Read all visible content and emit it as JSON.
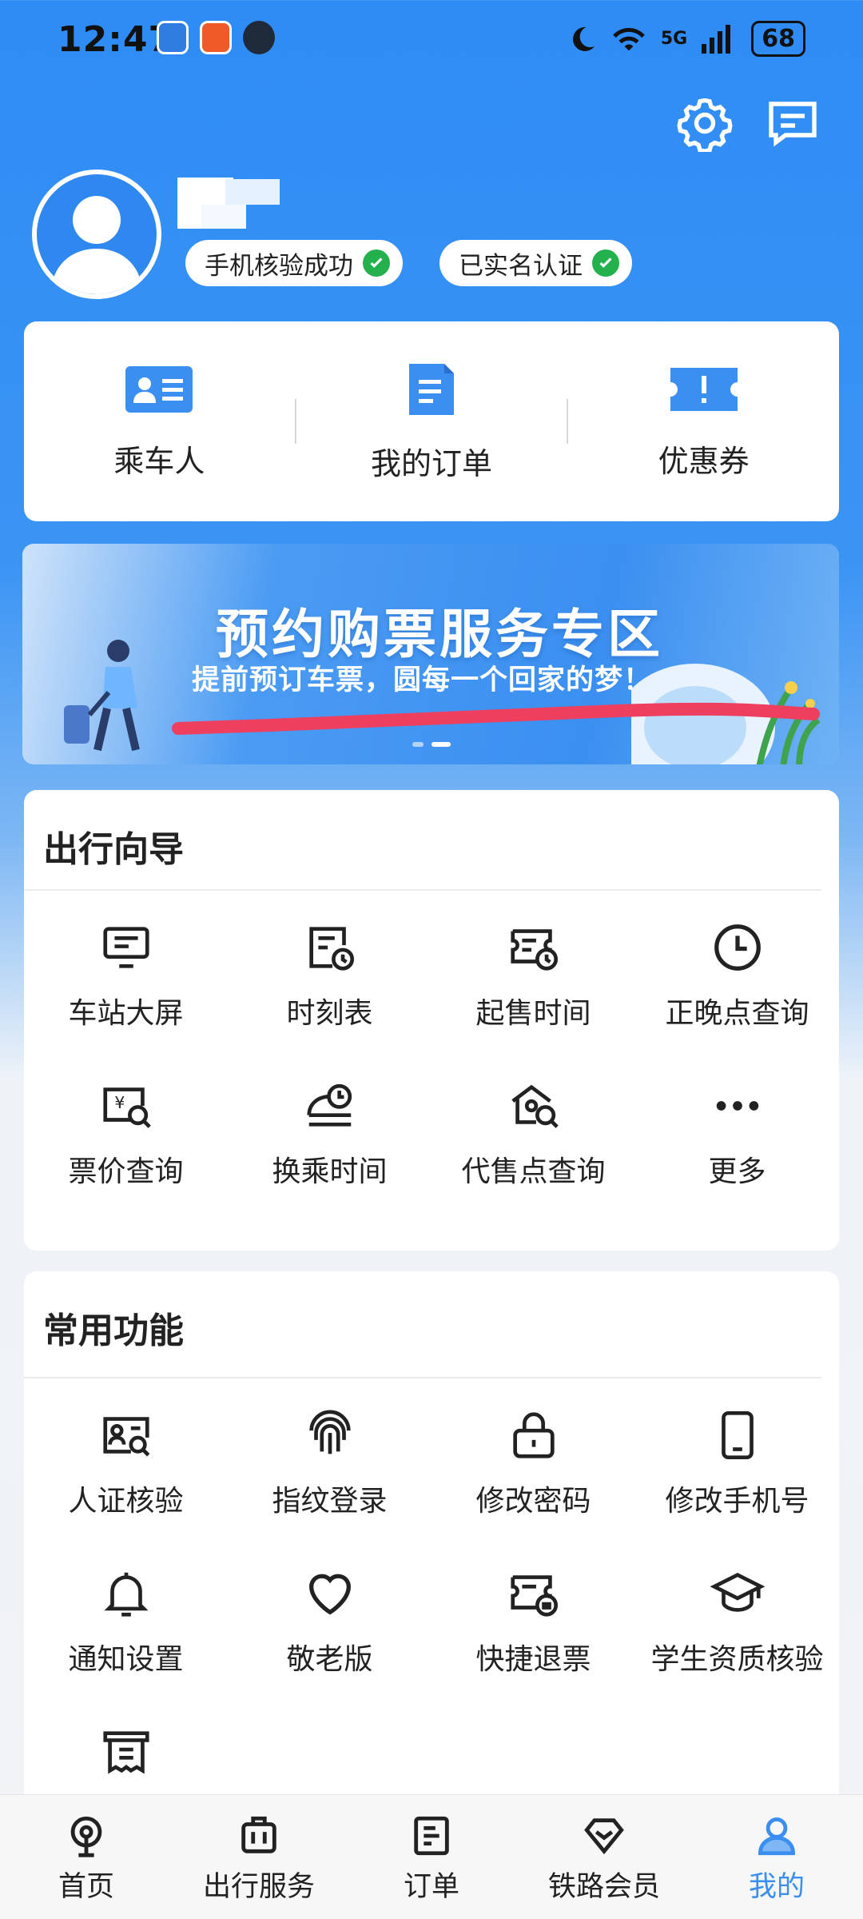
{
  "status_bar": {
    "time": "12:47",
    "network": "5G",
    "battery": "68"
  },
  "header": {
    "settings_icon": "gear-icon",
    "message_icon": "message-icon",
    "badges": [
      {
        "label": "手机核验成功"
      },
      {
        "label": "已实名认证"
      }
    ]
  },
  "quick_links": [
    {
      "label": "乘车人",
      "icon": "passenger-card-icon"
    },
    {
      "label": "我的订单",
      "icon": "order-doc-icon"
    },
    {
      "label": "优惠券",
      "icon": "coupon-icon"
    }
  ],
  "banner": {
    "title": "预约购票服务专区",
    "subtitle": "提前预订车票，圆每一个回家的梦！"
  },
  "travel_guide": {
    "title": "出行向导",
    "items": [
      {
        "label": "车站大屏",
        "icon": "monitor-icon"
      },
      {
        "label": "时刻表",
        "icon": "timetable-icon"
      },
      {
        "label": "起售时间",
        "icon": "ticket-clock-icon"
      },
      {
        "label": "正晚点查询",
        "icon": "clock-icon"
      },
      {
        "label": "票价查询",
        "icon": "price-search-icon"
      },
      {
        "label": "换乘时间",
        "icon": "transfer-time-icon"
      },
      {
        "label": "代售点查询",
        "icon": "agency-search-icon"
      },
      {
        "label": "更多",
        "icon": "more-icon"
      }
    ]
  },
  "common_functions": {
    "title": "常用功能",
    "items": [
      {
        "label": "人证核验",
        "icon": "id-verify-icon"
      },
      {
        "label": "指纹登录",
        "icon": "fingerprint-icon"
      },
      {
        "label": "修改密码",
        "icon": "lock-icon"
      },
      {
        "label": "修改手机号",
        "icon": "phone-icon"
      },
      {
        "label": "通知设置",
        "icon": "bell-icon"
      },
      {
        "label": "敬老版",
        "icon": "heart-icon"
      },
      {
        "label": "快捷退票",
        "icon": "refund-ticket-icon"
      },
      {
        "label": "学生资质核验",
        "icon": "graduation-cap-icon"
      },
      {
        "label": "",
        "icon": "receipt-icon"
      }
    ]
  },
  "bottom_nav": [
    {
      "label": "首页",
      "icon": "home-train-icon"
    },
    {
      "label": "出行服务",
      "icon": "luggage-icon"
    },
    {
      "label": "订单",
      "icon": "order-icon"
    },
    {
      "label": "铁路会员",
      "icon": "diamond-icon"
    },
    {
      "label": "我的",
      "icon": "profile-icon",
      "active": true
    }
  ],
  "colors": {
    "primary": "#2f8cf5",
    "active_tab": "#3a8ef0",
    "check_green": "#22b14c"
  }
}
